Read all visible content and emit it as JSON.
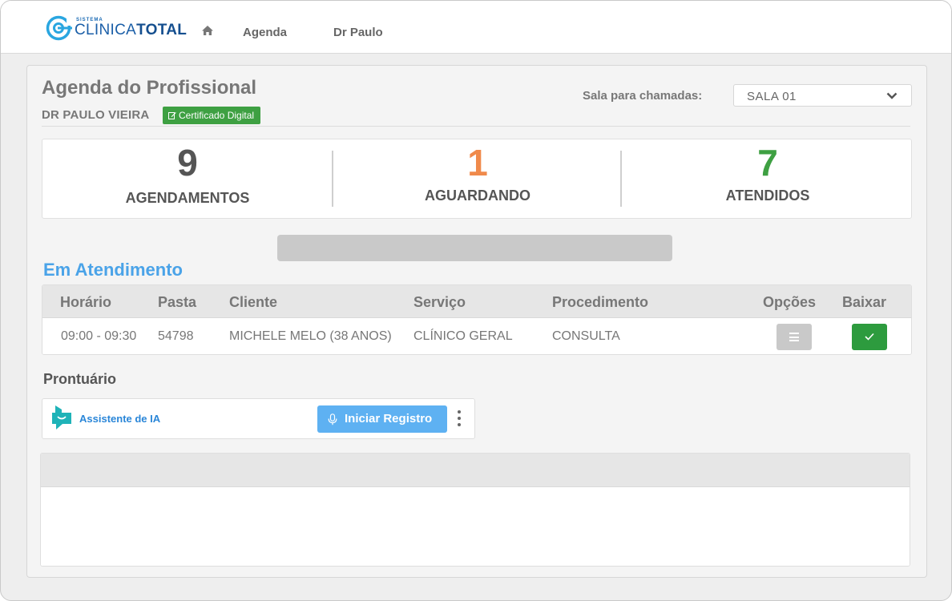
{
  "app": {
    "logo_small": "SISTEMA",
    "logo_main_light": "CLINICA",
    "logo_main_bold": "TOTAL"
  },
  "nav": {
    "home_icon": "home-icon",
    "agenda": "Agenda",
    "doctor": "Dr Paulo"
  },
  "header": {
    "title": "Agenda do Profissional",
    "doctor_name": "DR PAULO VIEIRA",
    "cert_badge": "Certificado Digital",
    "room_label": "Sala para chamadas:",
    "room_value": "SALA 01"
  },
  "stats": [
    {
      "value": "9",
      "label": "AGENDAMENTOS",
      "color": "#555555"
    },
    {
      "value": "1",
      "label": "AGUARDANDO",
      "color": "#f08a4b"
    },
    {
      "value": "7",
      "label": "ATENDIDOS",
      "color": "#3ea042"
    }
  ],
  "in_service": {
    "title": "Em Atendimento",
    "columns": [
      "Horário",
      "Pasta",
      "Cliente",
      "Serviço",
      "Procedimento",
      "Opções",
      "Baixar"
    ],
    "rows": [
      {
        "time": "09:00 - 09:30",
        "folder": "54798",
        "client": "MICHELE MELO (38 ANOS)",
        "service": "CLÍNICO GERAL",
        "procedure": "CONSULTA"
      }
    ]
  },
  "record": {
    "title": "Prontuário",
    "ai_label": "Assistente de IA",
    "start_button": "Iniciar Registro"
  },
  "colors": {
    "accent_blue": "#4aa3e8",
    "success_green": "#3ea042",
    "warning_orange": "#f08a4b",
    "button_blue": "#5eb1f2"
  }
}
